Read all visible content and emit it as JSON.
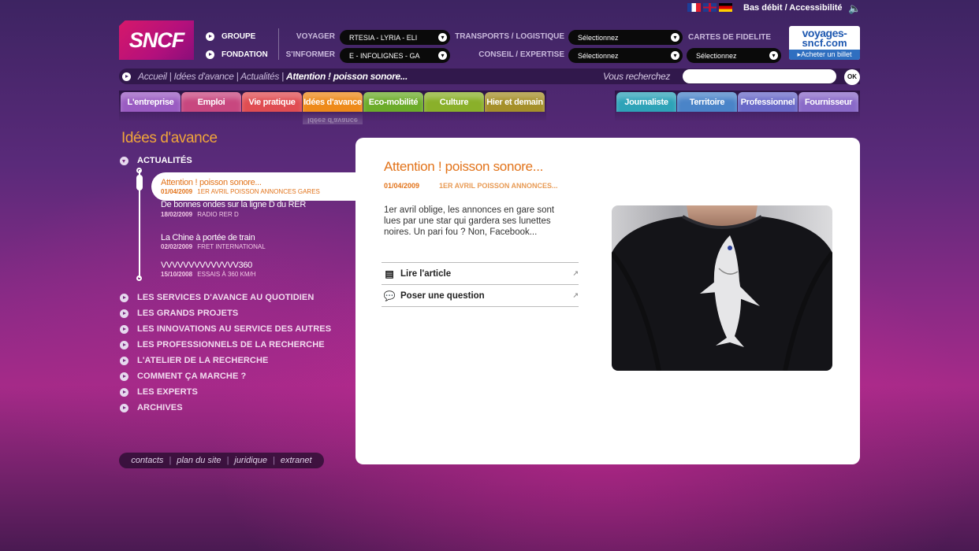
{
  "top": {
    "languages": [
      "Français",
      "English",
      "Deutsch"
    ],
    "accessibility": "Bas débit / Accessibilité",
    "logo": "SNCF",
    "links": [
      "GROUPE",
      "FONDATION"
    ],
    "voyager": {
      "label": "VOYAGER",
      "value": "RTESIA  -  LYRIA  -  ELI"
    },
    "informer": {
      "label": "S'INFORMER",
      "value": "E  -  INFOLIGNES  -  GA"
    },
    "transports": {
      "label": "TRANSPORTS / LOGISTIQUE",
      "value": "Sélectionnez"
    },
    "conseil": {
      "label": "CONSEIL / EXPERTISE",
      "value": "Sélectionnez"
    },
    "cartes": {
      "label": "CARTES DE FIDELITE",
      "value": "Sélectionnez"
    },
    "voyages": {
      "line1": "voyages-",
      "line2": "sncf.com",
      "cta": "▸Acheter un billet"
    }
  },
  "breadcrumb": {
    "items": [
      "Accueil",
      "Idées d'avance",
      "Actualités"
    ],
    "current": "Attention ! poisson sonore...",
    "search_label": "Vous recherchez",
    "search_placeholder": "",
    "ok": "OK"
  },
  "tabs_left": [
    {
      "label": "L'entreprise",
      "color": "#9a5cc2"
    },
    {
      "label": "Emploi",
      "color": "#c8477f"
    },
    {
      "label": "Vie pratique",
      "color": "#e04d52"
    },
    {
      "label": "Idées d'avance",
      "color": "#ee8a1a"
    },
    {
      "label": "Eco-mobilité",
      "color": "#6cac2a"
    },
    {
      "label": "Culture",
      "color": "#8ab02a"
    },
    {
      "label": "Hier et demain",
      "color": "#a5902a"
    }
  ],
  "tabs_right": [
    {
      "label": "Journaliste",
      "color": "#2ea3b8"
    },
    {
      "label": "Territoire",
      "color": "#4a84c8"
    },
    {
      "label": "Professionnel",
      "color": "#6a6ac8"
    },
    {
      "label": "Fournisseur",
      "color": "#8a6ac8"
    }
  ],
  "sidebar": {
    "title": "Idées d'avance",
    "subhead": "ACTUALITÉS",
    "news": [
      {
        "title": "Attention ! poisson sonore...",
        "date": "01/04/2009",
        "tag": "1ER AVRIL POISSON ANNONCES GARES"
      },
      {
        "title": "De bonnes ondes sur la ligne D du RER",
        "date": "18/02/2009",
        "tag": "RADIO RER D"
      },
      {
        "title": "La Chine à portée de train",
        "date": "02/02/2009",
        "tag": "FRET INTERNATIONAL"
      },
      {
        "title": "VVVVVVVVVVVVVV360",
        "date": "15/10/2008",
        "tag": "ESSAIS À 360 KM/H"
      }
    ],
    "nav": [
      "LES SERVICES D'AVANCE AU QUOTIDIEN",
      "LES GRANDS PROJETS",
      "LES INNOVATIONS AU SERVICE DES AUTRES",
      "LES PROFESSIONNELS DE LA RECHERCHE",
      "L'ATELIER DE LA RECHERCHE",
      "COMMENT ÇA MARCHE ?",
      "LES EXPERTS",
      "ARCHIVES"
    ]
  },
  "footer": {
    "links": [
      "contacts",
      "plan du site",
      "juridique",
      "extranet"
    ]
  },
  "article": {
    "title": "Attention ! poisson sonore...",
    "date": "01/04/2009",
    "tag": "1ER AVRIL POISSON ANNONCES...",
    "text": "1er avril oblige, les annonces en gare sont lues par une star qui gardera ses lunettes noires. Un pari fou ? Non, Facebook...",
    "actions": [
      "Lire l'article",
      "Poser une question"
    ]
  }
}
